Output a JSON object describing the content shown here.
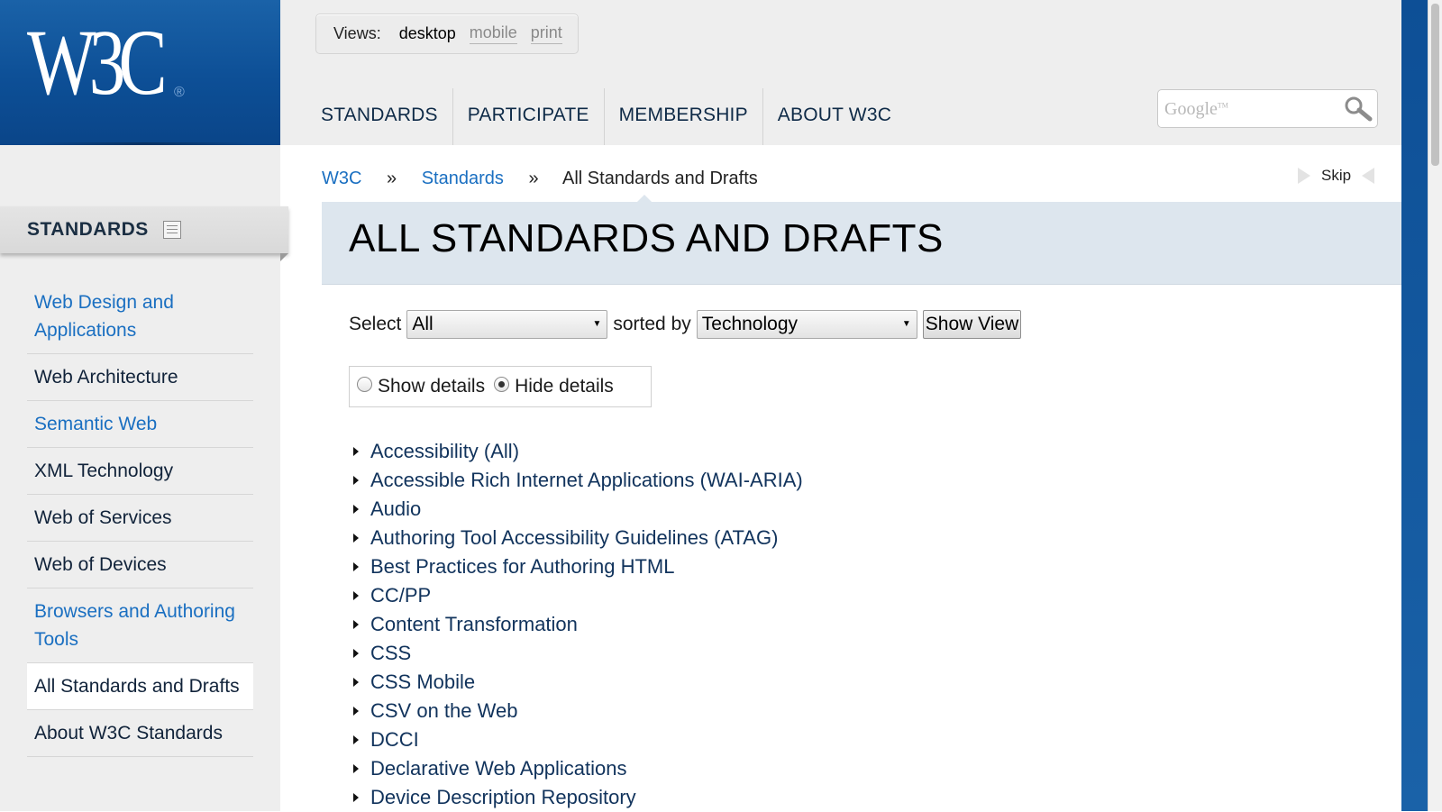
{
  "logo": {
    "text": "W3C",
    "registered": "®"
  },
  "views": {
    "label": "Views:",
    "options": [
      "desktop",
      "mobile",
      "print"
    ],
    "active": "desktop"
  },
  "nav": {
    "items": [
      "STANDARDS",
      "PARTICIPATE",
      "MEMBERSHIP",
      "ABOUT W3C"
    ]
  },
  "search": {
    "placeholder_brand": "Google",
    "placeholder_tm": "TM"
  },
  "sidebar": {
    "heading": "STANDARDS",
    "items": [
      {
        "label": "Web Design and Applications"
      },
      {
        "label": "Web Architecture"
      },
      {
        "label": "Semantic Web"
      },
      {
        "label": "XML Technology"
      },
      {
        "label": "Web of Services"
      },
      {
        "label": "Web of Devices"
      },
      {
        "label": "Browsers and Authoring Tools"
      },
      {
        "label": "All Standards and Drafts"
      },
      {
        "label": "About W3C Standards"
      }
    ]
  },
  "breadcrumb": {
    "items": [
      "W3C",
      "Standards",
      "All Standards and Drafts"
    ],
    "separator": "»"
  },
  "skip": {
    "label": "Skip"
  },
  "page": {
    "title": "ALL STANDARDS AND DRAFTS"
  },
  "filter": {
    "select_label": "Select",
    "select_value": "All",
    "sorted_label": "sorted by",
    "sort_value": "Technology",
    "button_label": "Show View"
  },
  "details": {
    "show_label": "Show details",
    "hide_label": "Hide details",
    "selected": "hide"
  },
  "standards": [
    "Accessibility (All)",
    "Accessible Rich Internet Applications (WAI-ARIA)",
    "Audio",
    "Authoring Tool Accessibility Guidelines (ATAG)",
    "Best Practices for Authoring HTML",
    "CC/PP",
    "Content Transformation",
    "CSS",
    "CSS Mobile",
    "CSV on the Web",
    "DCCI",
    "Declarative Web Applications",
    "Device Description Repository"
  ],
  "colors": {
    "brand_blue": "#0d4f96",
    "link_blue": "#1a6fc1",
    "title_band": "#dde6ee"
  }
}
